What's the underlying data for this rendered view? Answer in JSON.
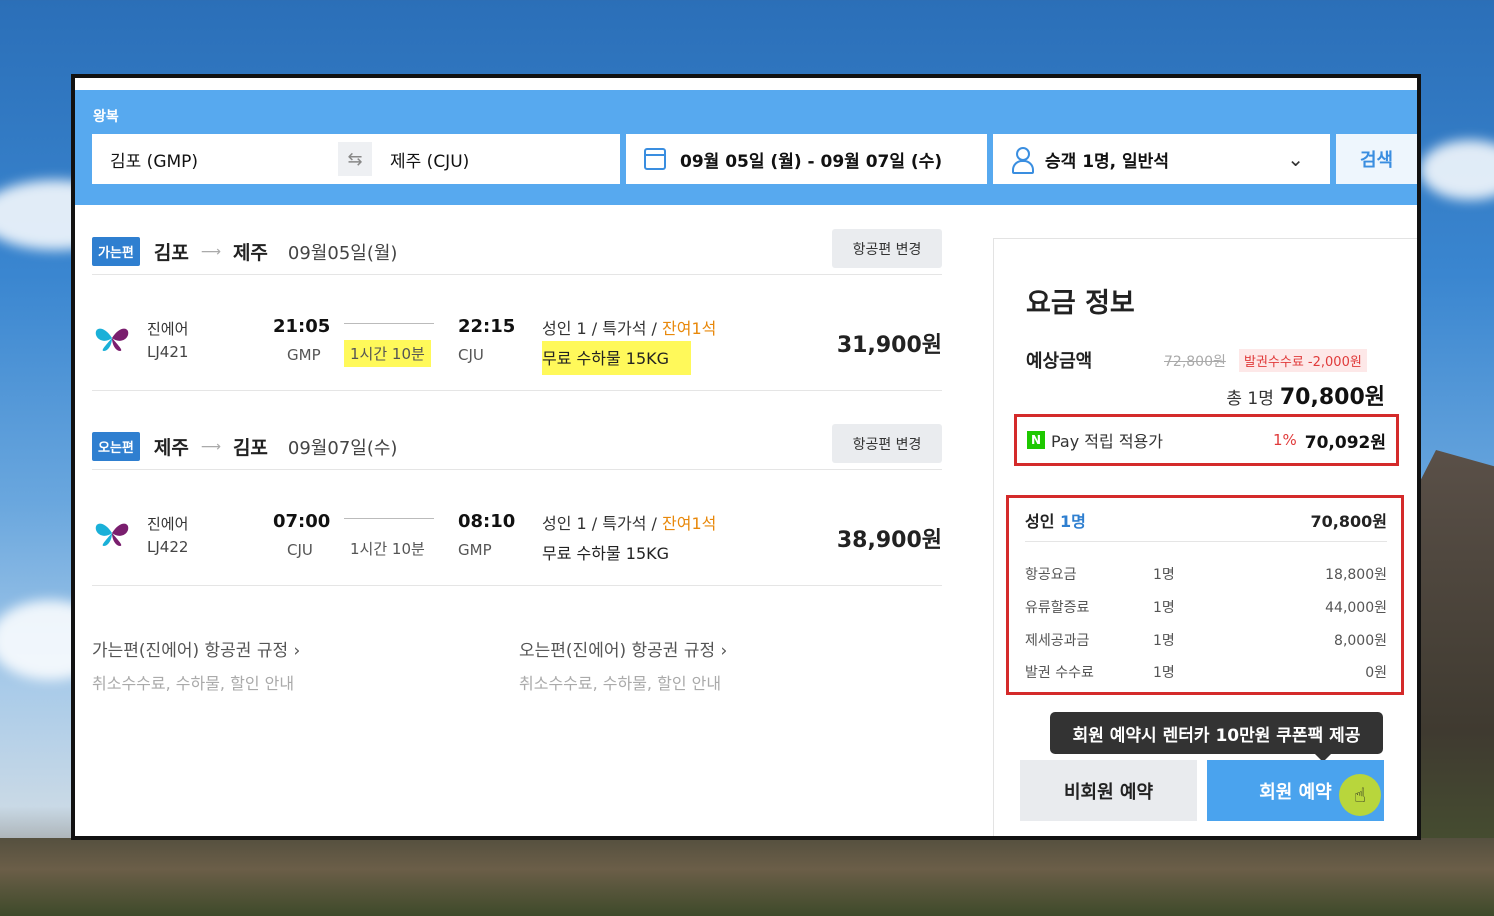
{
  "search": {
    "trip_type": "왕복",
    "from": "김포 (GMP)",
    "to": "제주 (CJU)",
    "dates": "09월 05일 (월)  -  09월 07일 (수)",
    "passengers": "승객 1명, 일반석",
    "search_label": "검색",
    "swap_icon": "⇆"
  },
  "outbound": {
    "badge": "가는편",
    "from_city": "김포",
    "to_city": "제주",
    "date": "09월05일(월)",
    "change_label": "항공편 변경",
    "airline": "진에어",
    "flight_no": "LJ421",
    "dep_time": "21:05",
    "dep_airport": "GMP",
    "duration": "1시간 10분",
    "arr_time": "22:15",
    "arr_airport": "CJU",
    "fare_text": "성인 1 / 특가석 / ",
    "seats_left": "잔여1석",
    "baggage": "무료 수하물 15KG",
    "price": "31,900원"
  },
  "inbound": {
    "badge": "오는편",
    "from_city": "제주",
    "to_city": "김포",
    "date": "09월07일(수)",
    "change_label": "항공편 변경",
    "airline": "진에어",
    "flight_no": "LJ422",
    "dep_time": "07:00",
    "dep_airport": "CJU",
    "duration": "1시간 10분",
    "arr_time": "08:10",
    "arr_airport": "GMP",
    "fare_text": "성인 1 / 특가석 / ",
    "seats_left": "잔여1석",
    "baggage": "무료 수하물 15KG",
    "price": "38,900원"
  },
  "rules": {
    "outbound_title": "가는편(진에어) 항공권 규정  ›",
    "outbound_sub": "취소수수료, 수하물, 할인 안내",
    "inbound_title": "오는편(진에어) 항공권 규정  ›",
    "inbound_sub": "취소수수료, 수하물, 할인 안내"
  },
  "fare_info": {
    "title": "요금 정보",
    "estimate_label": "예상금액",
    "original_price": "72,800원",
    "fee_discount": "발권수수료 -2,000원",
    "total_prefix": "총 1명",
    "total_amount": "70,800원",
    "npay_logo": "N",
    "npay_label": "Pay 적립 적용가",
    "npay_percent": "1%",
    "npay_price": "70,092원",
    "adult_label": "성인 ",
    "adult_count": "1명",
    "adult_amount": "70,800원",
    "rows": [
      {
        "label": "항공요금",
        "qty": "1명",
        "value": "18,800원"
      },
      {
        "label": "유류할증료",
        "qty": "1명",
        "value": "44,000원"
      },
      {
        "label": "제세공과금",
        "qty": "1명",
        "value": "8,000원"
      },
      {
        "label": "발권 수수료",
        "qty": "1명",
        "value": "0원"
      }
    ],
    "tooltip": "회원 예약시 렌터카 10만원 쿠폰팩 제공",
    "guest_button": "비회원 예약",
    "member_button": "회원 예약",
    "cursor_icon": "☝"
  }
}
